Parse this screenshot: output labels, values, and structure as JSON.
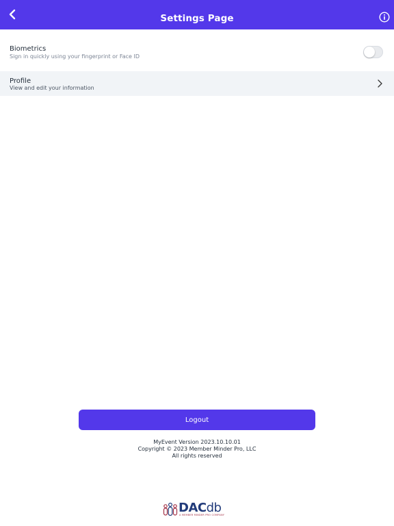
{
  "header": {
    "title": "Settings Page",
    "background": "#5338ea",
    "back_icon": "chevron-left-icon",
    "info_icon": "info-circle-icon"
  },
  "settings": {
    "biometrics": {
      "title": "Biometrics",
      "subtitle": "Sign in quickly using your fingerprint or Face ID",
      "enabled": false
    },
    "profile": {
      "title": "Profile",
      "subtitle": "View and edit your information",
      "icon": "chevron-right-icon"
    }
  },
  "logout_button": {
    "label": "Logout",
    "color": "#5338ea"
  },
  "footer": {
    "version": "MyEvent Version 2023.10.10.01",
    "copyright": "Copyright © 2023  Member Minder Pro, LLC",
    "rights": "All rights reserved"
  },
  "brand": {
    "name_bold": "DAC",
    "name_light": "db",
    "tagline": "A MEMBER MINDER PRO COMPANY"
  }
}
